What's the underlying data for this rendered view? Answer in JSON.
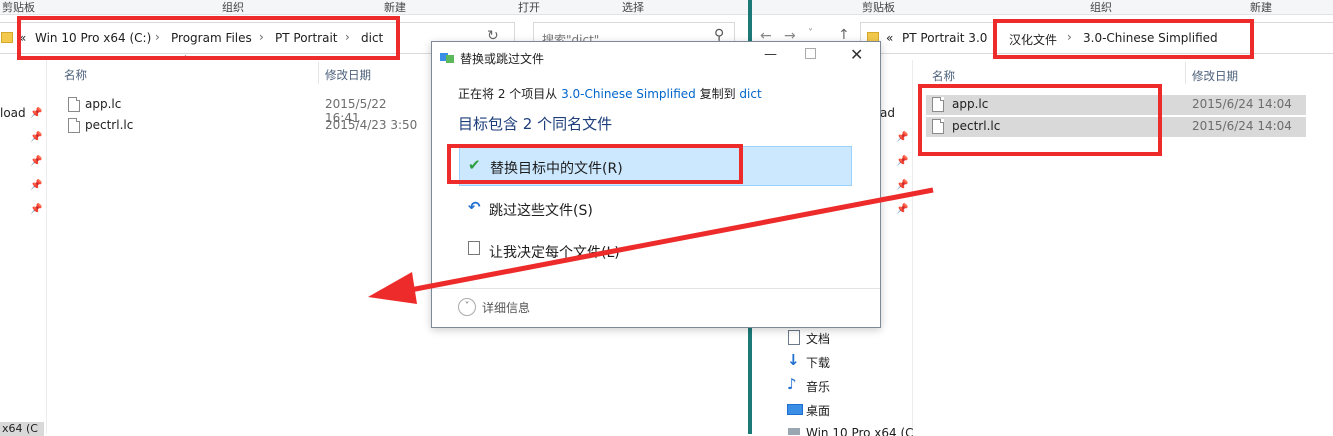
{
  "left_window": {
    "ribbon": {
      "clipboard": "剪贴板",
      "organize": "组织",
      "new": "新建",
      "open": "打开",
      "select": "选择"
    },
    "breadcrumb": [
      "Win 10 Pro x64 (C:)",
      "Program Files",
      "PT Portrait",
      "dict"
    ],
    "overflow": "«",
    "search_placeholder": "搜索\"dict\"",
    "columns": {
      "name": "名称",
      "modified": "修改日期"
    },
    "files": [
      {
        "name": "app.lc",
        "date": "2015/5/22 16:41"
      },
      {
        "name": "pectrl.lc",
        "date": "2015/4/23 3:50"
      }
    ],
    "nav_partial_text": "load",
    "drive_partial": "x64 (C"
  },
  "right_window": {
    "ribbon": {
      "clipboard": "剪贴板",
      "organize": "组织",
      "new": "新建"
    },
    "overflow": "«",
    "breadcrumb": [
      "PT Portrait 3.0",
      "汉化文件",
      "3.0-Chinese Simplified"
    ],
    "columns": {
      "name": "名称",
      "modified": "修改日期"
    },
    "files": [
      {
        "name": "app.lc",
        "date": "2015/6/24 14:04"
      },
      {
        "name": "pectrl.lc",
        "date": "2015/6/24 14:04"
      }
    ],
    "nav_partial_text": "ad",
    "nav_items": [
      {
        "label": "文档",
        "icon": "document-icon"
      },
      {
        "label": "下载",
        "icon": "download-icon"
      },
      {
        "label": "音乐",
        "icon": "music-icon"
      },
      {
        "label": "桌面",
        "icon": "desktop-icon"
      },
      {
        "label": "Win 10 Pro x64 (C",
        "icon": "drive-icon"
      }
    ]
  },
  "dialog": {
    "title": "替换或跳过文件",
    "copy_prefix": "正在将 2 个项目从 ",
    "source": "3.0-Chinese Simplified",
    "copy_middle": " 复制到 ",
    "dest": "dict",
    "heading": "目标包含 2 个同名文件",
    "options": {
      "replace": "替换目标中的文件(R)",
      "skip": "跳过这些文件(S)",
      "decide": "让我决定每个文件(L)"
    },
    "details": "详细信息"
  },
  "colors": {
    "highlight_red": "#ee2b2b",
    "selection_blue": "#cce8ff",
    "link_blue": "#0066cc",
    "window_border_teal": "#1b7a78"
  }
}
